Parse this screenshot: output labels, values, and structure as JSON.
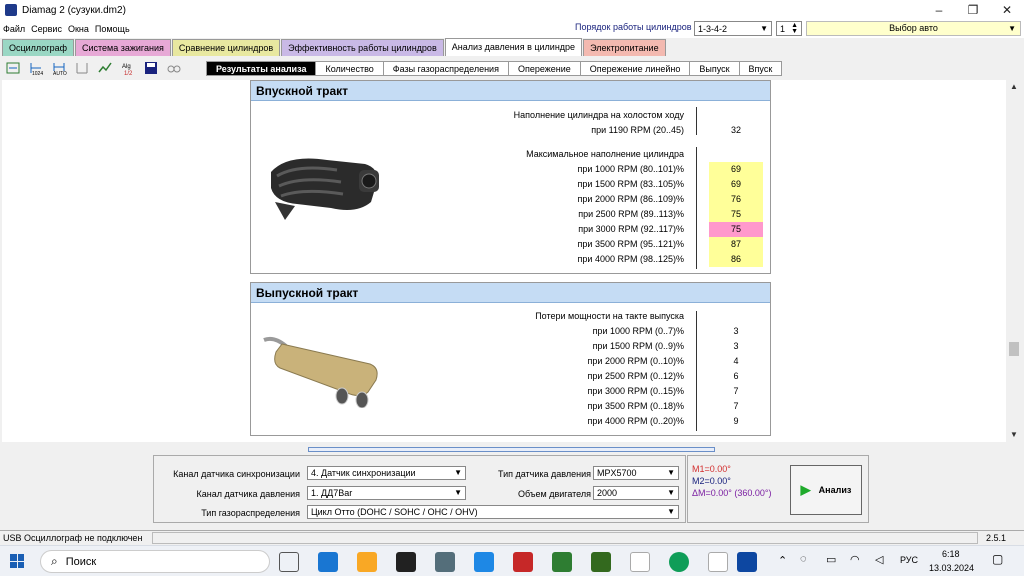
{
  "window": {
    "title": "Diamag 2 (сузуки.dm2)",
    "minimize": "–",
    "maximize": "❐",
    "close": "✕"
  },
  "menu": [
    "Файл",
    "Сервис",
    "Окна",
    "Помощь"
  ],
  "header": {
    "cyl_order_label": "Порядок работы цилиндров",
    "cyl_order_value": "1-3-4-2",
    "cyl_num_value": "1",
    "auto_select": "Выбор авто"
  },
  "tabs": [
    {
      "label": "Осциллограф",
      "color": "#9ad7c4"
    },
    {
      "label": "Система зажигания",
      "color": "#e7a9d6"
    },
    {
      "label": "Сравнение цилиндров",
      "color": "#e8e8a0"
    },
    {
      "label": "Эффективность работы цилиндров",
      "color": "#c9b9e6"
    },
    {
      "label": "Анализ давления в цилиндре",
      "color": "#ffffff"
    },
    {
      "label": "Электропитание",
      "color": "#f3b9b0"
    }
  ],
  "toolbar_icons": [
    "sync-icon",
    "counter-icon",
    "auto-icon",
    "range-icon",
    "graph-icon",
    "algorithm-icon",
    "save-icon",
    "compare-icon"
  ],
  "subtabs": [
    "Результаты анализа",
    "Количество",
    "Фазы газораспределения",
    "Опережение",
    "Опережение линейно",
    "Выпуск",
    "Впуск"
  ],
  "intake": {
    "title": "Впускной тракт",
    "idle_title": "Наполнение цилиндра на холостом ходу",
    "idle_label": "при 1190 RPM (20..45)",
    "idle_value": "32",
    "max_title": "Максимальное наполнение цилиндра",
    "rows": [
      {
        "label": "при  1000 RPM (80..101)%",
        "value": "69",
        "hl": "y"
      },
      {
        "label": "при  1500 RPM (83..105)%",
        "value": "69",
        "hl": "y"
      },
      {
        "label": "при  2000 RPM (86..109)%",
        "value": "76",
        "hl": "y"
      },
      {
        "label": "при  2500 RPM (89..113)%",
        "value": "75",
        "hl": "y"
      },
      {
        "label": "при  3000 RPM (92..117)%",
        "value": "75",
        "hl": "p"
      },
      {
        "label": "при  3500 RPM (95..121)%",
        "value": "87",
        "hl": "y"
      },
      {
        "label": "при  4000 RPM (98..125)%",
        "value": "86",
        "hl": "y"
      }
    ]
  },
  "exhaust": {
    "title": "Выпускной тракт",
    "loss_title": "Потери мощности на такте выпуска",
    "rows": [
      {
        "label": "при  1000 RPM (0..7)%",
        "value": "3"
      },
      {
        "label": "при  1500 RPM (0..9)%",
        "value": "3"
      },
      {
        "label": "при  2000 RPM (0..10)%",
        "value": "4"
      },
      {
        "label": "при  2500 RPM (0..12)%",
        "value": "6"
      },
      {
        "label": "при  3000 RPM (0..15)%",
        "value": "7"
      },
      {
        "label": "при  3500 RPM (0..18)%",
        "value": "7"
      },
      {
        "label": "при  4000 RPM (0..20)%",
        "value": "9"
      }
    ]
  },
  "settings": {
    "sync_label": "Канал датчика синхронизации",
    "sync_value": "4.  Датчик синхронизации",
    "pressure_label": "Канал датчика давления",
    "pressure_value": "1.  ДД7Bar",
    "gas_label": "Тип газораспределения",
    "gas_value": "Цикл Отто (DOHC / SOHC / OHC / OHV)",
    "sensor_type_label": "Тип датчика давления",
    "sensor_type_value": "MPX5700",
    "volume_label": "Объем двигателя",
    "volume_value": "2000"
  },
  "markers": {
    "m1": "M1=0.00°",
    "m2": "M2=0.00°",
    "dm": "ΔM=0.00° (360.00°)"
  },
  "analyze_label": "Анализ",
  "status": {
    "left": "USB Осциллограф не подключен",
    "version": "2.5.1"
  },
  "taskbar": {
    "search": "Поиск",
    "lang": "РУС",
    "time": "6:18",
    "date": "13.03.2024"
  }
}
